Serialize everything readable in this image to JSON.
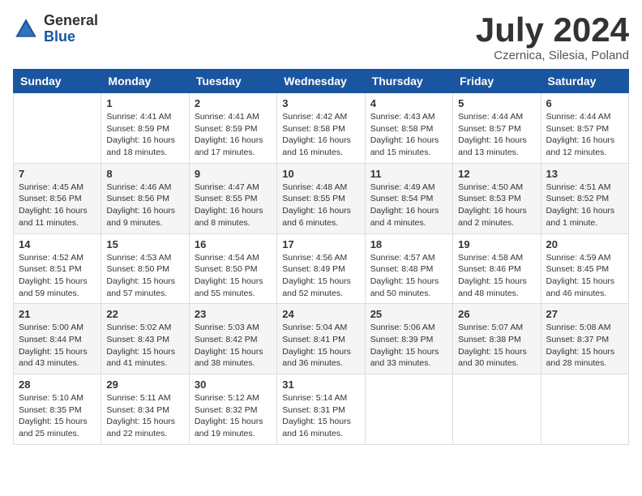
{
  "logo": {
    "general": "General",
    "blue": "Blue"
  },
  "title": {
    "month_year": "July 2024",
    "location": "Czernica, Silesia, Poland"
  },
  "headers": [
    "Sunday",
    "Monday",
    "Tuesday",
    "Wednesday",
    "Thursday",
    "Friday",
    "Saturday"
  ],
  "weeks": [
    [
      {
        "day": "",
        "info": ""
      },
      {
        "day": "1",
        "info": "Sunrise: 4:41 AM\nSunset: 8:59 PM\nDaylight: 16 hours\nand 18 minutes."
      },
      {
        "day": "2",
        "info": "Sunrise: 4:41 AM\nSunset: 8:59 PM\nDaylight: 16 hours\nand 17 minutes."
      },
      {
        "day": "3",
        "info": "Sunrise: 4:42 AM\nSunset: 8:58 PM\nDaylight: 16 hours\nand 16 minutes."
      },
      {
        "day": "4",
        "info": "Sunrise: 4:43 AM\nSunset: 8:58 PM\nDaylight: 16 hours\nand 15 minutes."
      },
      {
        "day": "5",
        "info": "Sunrise: 4:44 AM\nSunset: 8:57 PM\nDaylight: 16 hours\nand 13 minutes."
      },
      {
        "day": "6",
        "info": "Sunrise: 4:44 AM\nSunset: 8:57 PM\nDaylight: 16 hours\nand 12 minutes."
      }
    ],
    [
      {
        "day": "7",
        "info": "Sunrise: 4:45 AM\nSunset: 8:56 PM\nDaylight: 16 hours\nand 11 minutes."
      },
      {
        "day": "8",
        "info": "Sunrise: 4:46 AM\nSunset: 8:56 PM\nDaylight: 16 hours\nand 9 minutes."
      },
      {
        "day": "9",
        "info": "Sunrise: 4:47 AM\nSunset: 8:55 PM\nDaylight: 16 hours\nand 8 minutes."
      },
      {
        "day": "10",
        "info": "Sunrise: 4:48 AM\nSunset: 8:55 PM\nDaylight: 16 hours\nand 6 minutes."
      },
      {
        "day": "11",
        "info": "Sunrise: 4:49 AM\nSunset: 8:54 PM\nDaylight: 16 hours\nand 4 minutes."
      },
      {
        "day": "12",
        "info": "Sunrise: 4:50 AM\nSunset: 8:53 PM\nDaylight: 16 hours\nand 2 minutes."
      },
      {
        "day": "13",
        "info": "Sunrise: 4:51 AM\nSunset: 8:52 PM\nDaylight: 16 hours\nand 1 minute."
      }
    ],
    [
      {
        "day": "14",
        "info": "Sunrise: 4:52 AM\nSunset: 8:51 PM\nDaylight: 15 hours\nand 59 minutes."
      },
      {
        "day": "15",
        "info": "Sunrise: 4:53 AM\nSunset: 8:50 PM\nDaylight: 15 hours\nand 57 minutes."
      },
      {
        "day": "16",
        "info": "Sunrise: 4:54 AM\nSunset: 8:50 PM\nDaylight: 15 hours\nand 55 minutes."
      },
      {
        "day": "17",
        "info": "Sunrise: 4:56 AM\nSunset: 8:49 PM\nDaylight: 15 hours\nand 52 minutes."
      },
      {
        "day": "18",
        "info": "Sunrise: 4:57 AM\nSunset: 8:48 PM\nDaylight: 15 hours\nand 50 minutes."
      },
      {
        "day": "19",
        "info": "Sunrise: 4:58 AM\nSunset: 8:46 PM\nDaylight: 15 hours\nand 48 minutes."
      },
      {
        "day": "20",
        "info": "Sunrise: 4:59 AM\nSunset: 8:45 PM\nDaylight: 15 hours\nand 46 minutes."
      }
    ],
    [
      {
        "day": "21",
        "info": "Sunrise: 5:00 AM\nSunset: 8:44 PM\nDaylight: 15 hours\nand 43 minutes."
      },
      {
        "day": "22",
        "info": "Sunrise: 5:02 AM\nSunset: 8:43 PM\nDaylight: 15 hours\nand 41 minutes."
      },
      {
        "day": "23",
        "info": "Sunrise: 5:03 AM\nSunset: 8:42 PM\nDaylight: 15 hours\nand 38 minutes."
      },
      {
        "day": "24",
        "info": "Sunrise: 5:04 AM\nSunset: 8:41 PM\nDaylight: 15 hours\nand 36 minutes."
      },
      {
        "day": "25",
        "info": "Sunrise: 5:06 AM\nSunset: 8:39 PM\nDaylight: 15 hours\nand 33 minutes."
      },
      {
        "day": "26",
        "info": "Sunrise: 5:07 AM\nSunset: 8:38 PM\nDaylight: 15 hours\nand 30 minutes."
      },
      {
        "day": "27",
        "info": "Sunrise: 5:08 AM\nSunset: 8:37 PM\nDaylight: 15 hours\nand 28 minutes."
      }
    ],
    [
      {
        "day": "28",
        "info": "Sunrise: 5:10 AM\nSunset: 8:35 PM\nDaylight: 15 hours\nand 25 minutes."
      },
      {
        "day": "29",
        "info": "Sunrise: 5:11 AM\nSunset: 8:34 PM\nDaylight: 15 hours\nand 22 minutes."
      },
      {
        "day": "30",
        "info": "Sunrise: 5:12 AM\nSunset: 8:32 PM\nDaylight: 15 hours\nand 19 minutes."
      },
      {
        "day": "31",
        "info": "Sunrise: 5:14 AM\nSunset: 8:31 PM\nDaylight: 15 hours\nand 16 minutes."
      },
      {
        "day": "",
        "info": ""
      },
      {
        "day": "",
        "info": ""
      },
      {
        "day": "",
        "info": ""
      }
    ]
  ]
}
